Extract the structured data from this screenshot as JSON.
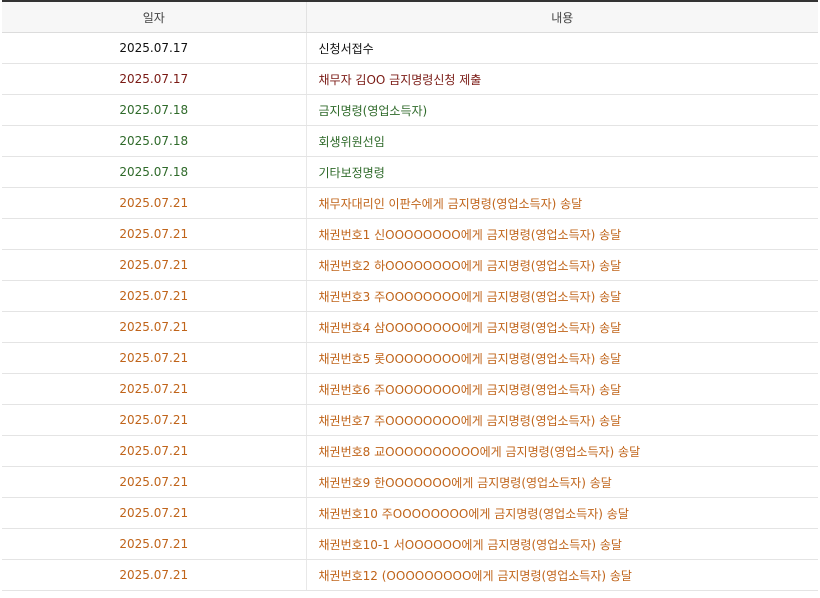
{
  "table": {
    "headers": {
      "date": "일자",
      "content": "내용"
    },
    "colors": {
      "black": "#111111",
      "darkred": "#7a1a14",
      "green": "#2f6a2a",
      "orange": "#c0641a"
    },
    "rows": [
      {
        "date": "2025.07.17",
        "content": "신청서접수",
        "color": "black"
      },
      {
        "date": "2025.07.17",
        "content": "채무자 김OO 금지명령신청 제출",
        "color": "darkred"
      },
      {
        "date": "2025.07.18",
        "content": "금지명령(영업소득자)",
        "color": "green"
      },
      {
        "date": "2025.07.18",
        "content": "회생위원선임",
        "color": "green"
      },
      {
        "date": "2025.07.18",
        "content": "기타보정명령",
        "color": "green"
      },
      {
        "date": "2025.07.21",
        "content": "채무자대리인 이판수에게 금지명령(영업소득자) 송달",
        "color": "orange"
      },
      {
        "date": "2025.07.21",
        "content": "채권번호1 신OOOOOOOO에게 금지명령(영업소득자) 송달",
        "color": "orange"
      },
      {
        "date": "2025.07.21",
        "content": "채권번호2 하OOOOOOOO에게 금지명령(영업소득자) 송달",
        "color": "orange"
      },
      {
        "date": "2025.07.21",
        "content": "채권번호3 주OOOOOOOO에게 금지명령(영업소득자) 송달",
        "color": "orange"
      },
      {
        "date": "2025.07.21",
        "content": "채권번호4 삼OOOOOOOO에게 금지명령(영업소득자) 송달",
        "color": "orange"
      },
      {
        "date": "2025.07.21",
        "content": "채권번호5 롯OOOOOOOO에게 금지명령(영업소득자) 송달",
        "color": "orange"
      },
      {
        "date": "2025.07.21",
        "content": "채권번호6 주OOOOOOOO에게 금지명령(영업소득자) 송달",
        "color": "orange"
      },
      {
        "date": "2025.07.21",
        "content": "채권번호7 주OOOOOOOO에게 금지명령(영업소득자) 송달",
        "color": "orange"
      },
      {
        "date": "2025.07.21",
        "content": "채권번호8 교OOOOOOOOOO에게 금지명령(영업소득자) 송달",
        "color": "orange"
      },
      {
        "date": "2025.07.21",
        "content": "채권번호9 한OOOOOOO에게 금지명령(영업소득자) 송달",
        "color": "orange"
      },
      {
        "date": "2025.07.21",
        "content": "채권번호10 주OOOOOOOO에게 금지명령(영업소득자) 송달",
        "color": "orange"
      },
      {
        "date": "2025.07.21",
        "content": "채권번호10-1 서OOOOOO에게 금지명령(영업소득자) 송달",
        "color": "orange"
      },
      {
        "date": "2025.07.21",
        "content": "채권번호12 (OOOOOOOOO에게 금지명령(영업소득자) 송달",
        "color": "orange"
      }
    ]
  }
}
